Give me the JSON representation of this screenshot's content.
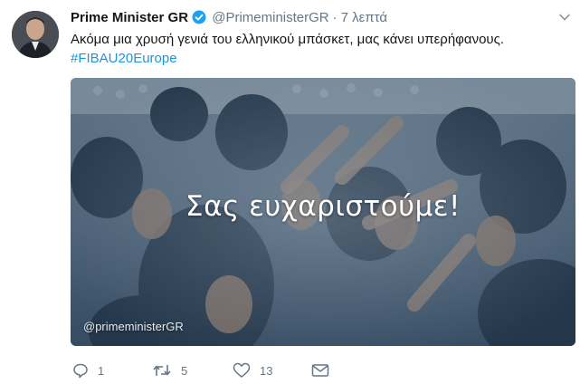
{
  "author": {
    "name": "Prime Minister GR",
    "handle": "@PrimeministerGR",
    "time": "7 λεπτά",
    "separator": "·"
  },
  "tweet": {
    "text": "Ακόμα μια χρυσή γενιά του ελληνικού μπάσκετ, μας κάνει υπερήφανους.",
    "hashtag": "#FIBAU20Europe"
  },
  "media": {
    "overlay_text": "Σας ευχαριστούμε!",
    "watermark": "@primeministerGR"
  },
  "actions": {
    "replies": "1",
    "retweets": "5",
    "likes": "13"
  },
  "colors": {
    "link": "#1b95e0",
    "secondary": "#657786",
    "verified": "#1da1f2"
  }
}
